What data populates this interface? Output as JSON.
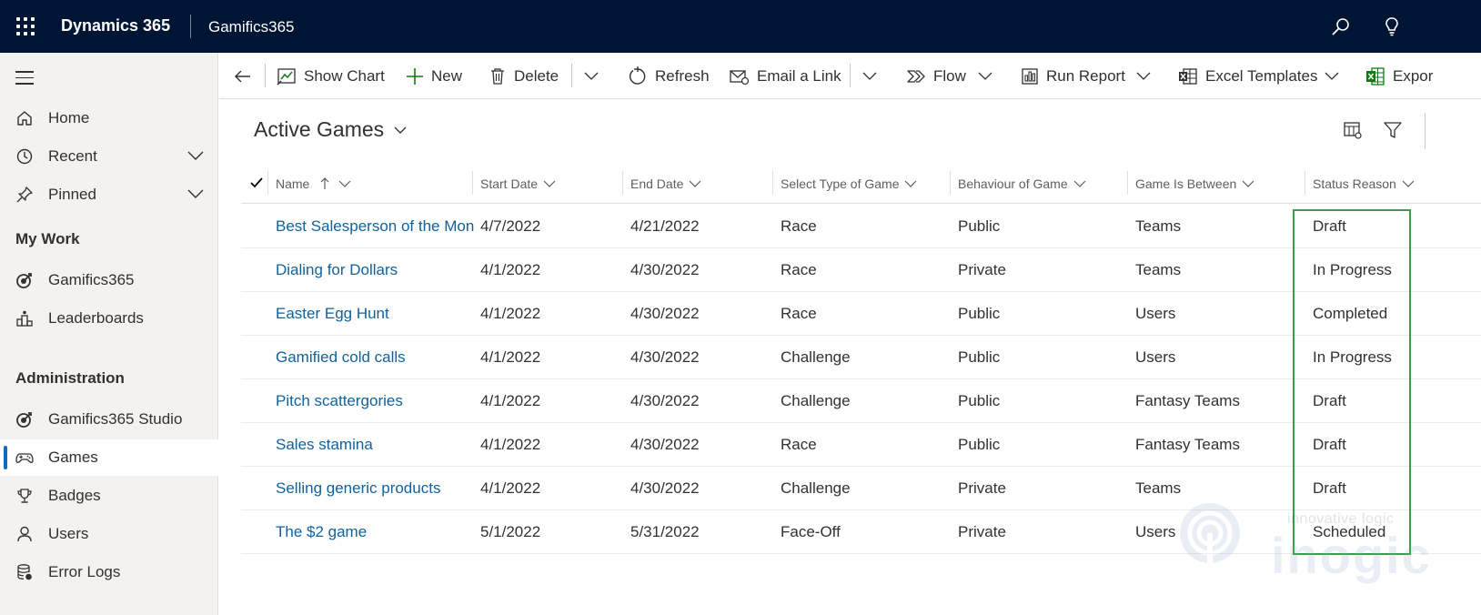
{
  "topbar": {
    "app_name": "Dynamics 365",
    "environment": "Gamifics365",
    "icons": [
      "waffle-icon",
      "search-icon",
      "lightbulb-icon"
    ]
  },
  "sidebar": {
    "home": "Home",
    "recent": "Recent",
    "pinned": "Pinned",
    "my_work_header": "My Work",
    "my_work_items": [
      "Gamifics365",
      "Leaderboards"
    ],
    "admin_header": "Administration",
    "admin_items": [
      "Gamifics365 Studio",
      "Games",
      "Badges",
      "Users",
      "Error Logs"
    ],
    "selected_item": "Games"
  },
  "commandbar": {
    "show_chart": "Show Chart",
    "new": "New",
    "delete": "Delete",
    "refresh": "Refresh",
    "email_link": "Email a Link",
    "flow": "Flow",
    "run_report": "Run Report",
    "excel_templates": "Excel Templates",
    "export": "Expor"
  },
  "view": {
    "title": "Active Games"
  },
  "grid": {
    "columns": [
      "Name",
      "Start Date",
      "End Date",
      "Select Type of Game",
      "Behaviour of Game",
      "Game Is Between",
      "Status Reason"
    ],
    "sort_column": "Name",
    "sort_direction": "ascending",
    "rows": [
      [
        "Best Salesperson of the Month",
        "4/7/2022",
        "4/21/2022",
        "Race",
        "Public",
        "Teams",
        "Draft"
      ],
      [
        "Dialing for Dollars",
        "4/1/2022",
        "4/30/2022",
        "Race",
        "Private",
        "Teams",
        "In Progress"
      ],
      [
        "Easter Egg Hunt",
        "4/1/2022",
        "4/30/2022",
        "Race",
        "Public",
        "Users",
        "Completed"
      ],
      [
        "Gamified cold calls",
        "4/1/2022",
        "4/30/2022",
        "Challenge",
        "Public",
        "Users",
        "In Progress"
      ],
      [
        "Pitch scattergories",
        "4/1/2022",
        "4/30/2022",
        "Challenge",
        "Public",
        "Fantasy Teams",
        "Draft"
      ],
      [
        "Sales stamina",
        "4/1/2022",
        "4/30/2022",
        "Race",
        "Public",
        "Fantasy Teams",
        "Draft"
      ],
      [
        "Selling generic products",
        "4/1/2022",
        "4/30/2022",
        "Challenge",
        "Private",
        "Teams",
        "Draft"
      ],
      [
        "The $2 game",
        "5/1/2022",
        "5/31/2022",
        "Face-Off",
        "Private",
        "Users",
        "Scheduled"
      ]
    ]
  },
  "watermark": {
    "line1": "innovative logic",
    "line2": "inogic"
  },
  "colors": {
    "topbar_bg": "#001433",
    "link": "#11629c",
    "highlight": "#3a9c47",
    "selected_indicator": "#0f6cbd"
  }
}
